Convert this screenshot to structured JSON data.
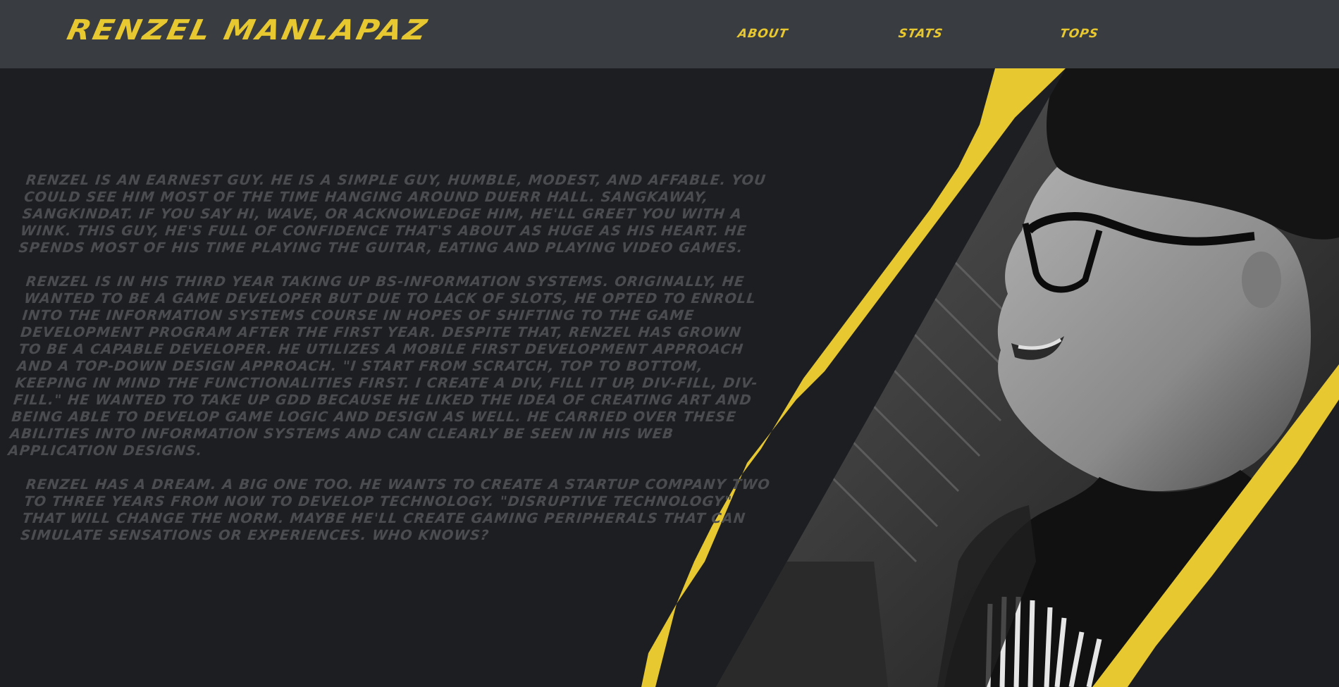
{
  "header": {
    "brand": "RENZEL MANLAPAZ",
    "nav": [
      {
        "label": "ABOUT"
      },
      {
        "label": "STATS"
      },
      {
        "label": "TOPS"
      }
    ]
  },
  "about": {
    "paragraphs": [
      "RENZEL IS AN EARNEST GUY. HE IS A SIMPLE GUY, HUMBLE, MODEST, AND AFFABLE. YOU COULD SEE HIM MOST OF THE TIME HANGING AROUND DUERR HALL. SANGKAWAY, SANGKINDAT. IF YOU SAY HI, WAVE, OR ACKNOWLEDGE HIM, HE'LL GREET YOU WITH A WINK. THIS GUY, HE'S FULL OF CONFIDENCE THAT'S ABOUT AS HUGE AS HIS HEART. HE SPENDS MOST OF HIS TIME PLAYING THE GUITAR, EATING AND PLAYING VIDEO GAMES.",
      "RENZEL IS IN HIS THIRD YEAR TAKING UP BS-INFORMATION SYSTEMS. ORIGINALLY, HE WANTED TO BE A GAME DEVELOPER BUT DUE TO LACK OF SLOTS, HE OPTED TO ENROLL INTO THE INFORMATION SYSTEMS COURSE IN HOPES OF SHIFTING TO THE GAME DEVELOPMENT PROGRAM AFTER THE FIRST YEAR. DESPITE THAT, RENZEL HAS GROWN TO BE A CAPABLE DEVELOPER. HE UTILIZES A MOBILE FIRST DEVELOPMENT APPROACH AND A TOP-DOWN DESIGN APPROACH. \"I START FROM SCRATCH, TOP TO BOTTOM, KEEPING IN MIND THE FUNCTIONALITIES FIRST. I CREATE A DIV, FILL IT UP, DIV-FILL, DIV-FILL.\" HE WANTED TO TAKE UP GDD BECAUSE HE LIKED THE IDEA OF CREATING ART AND BEING ABLE TO DEVELOP GAME LOGIC AND DESIGN AS WELL. HE CARRIED OVER THESE ABILITIES INTO INFORMATION SYSTEMS AND CAN CLEARLY BE SEEN IN HIS WEB APPLICATION DESIGNS.",
      "RENZEL HAS A DREAM. A BIG ONE TOO. HE WANTS TO CREATE A STARTUP COMPANY TWO TO THREE YEARS FROM NOW TO DEVELOP TECHNOLOGY. \"DISRUPTIVE TECHNOLOGY\" THAT WILL CHANGE THE NORM. MAYBE HE'LL CREATE GAMING PERIPHERALS THAT CAN SIMULATE SENSATIONS OR EXPERIENCES. WHO KNOWS?"
    ]
  },
  "colors": {
    "accent": "#e8c830",
    "navbar": "#393c40",
    "background": "#1c1e21",
    "body_text": "#4a4c50"
  }
}
